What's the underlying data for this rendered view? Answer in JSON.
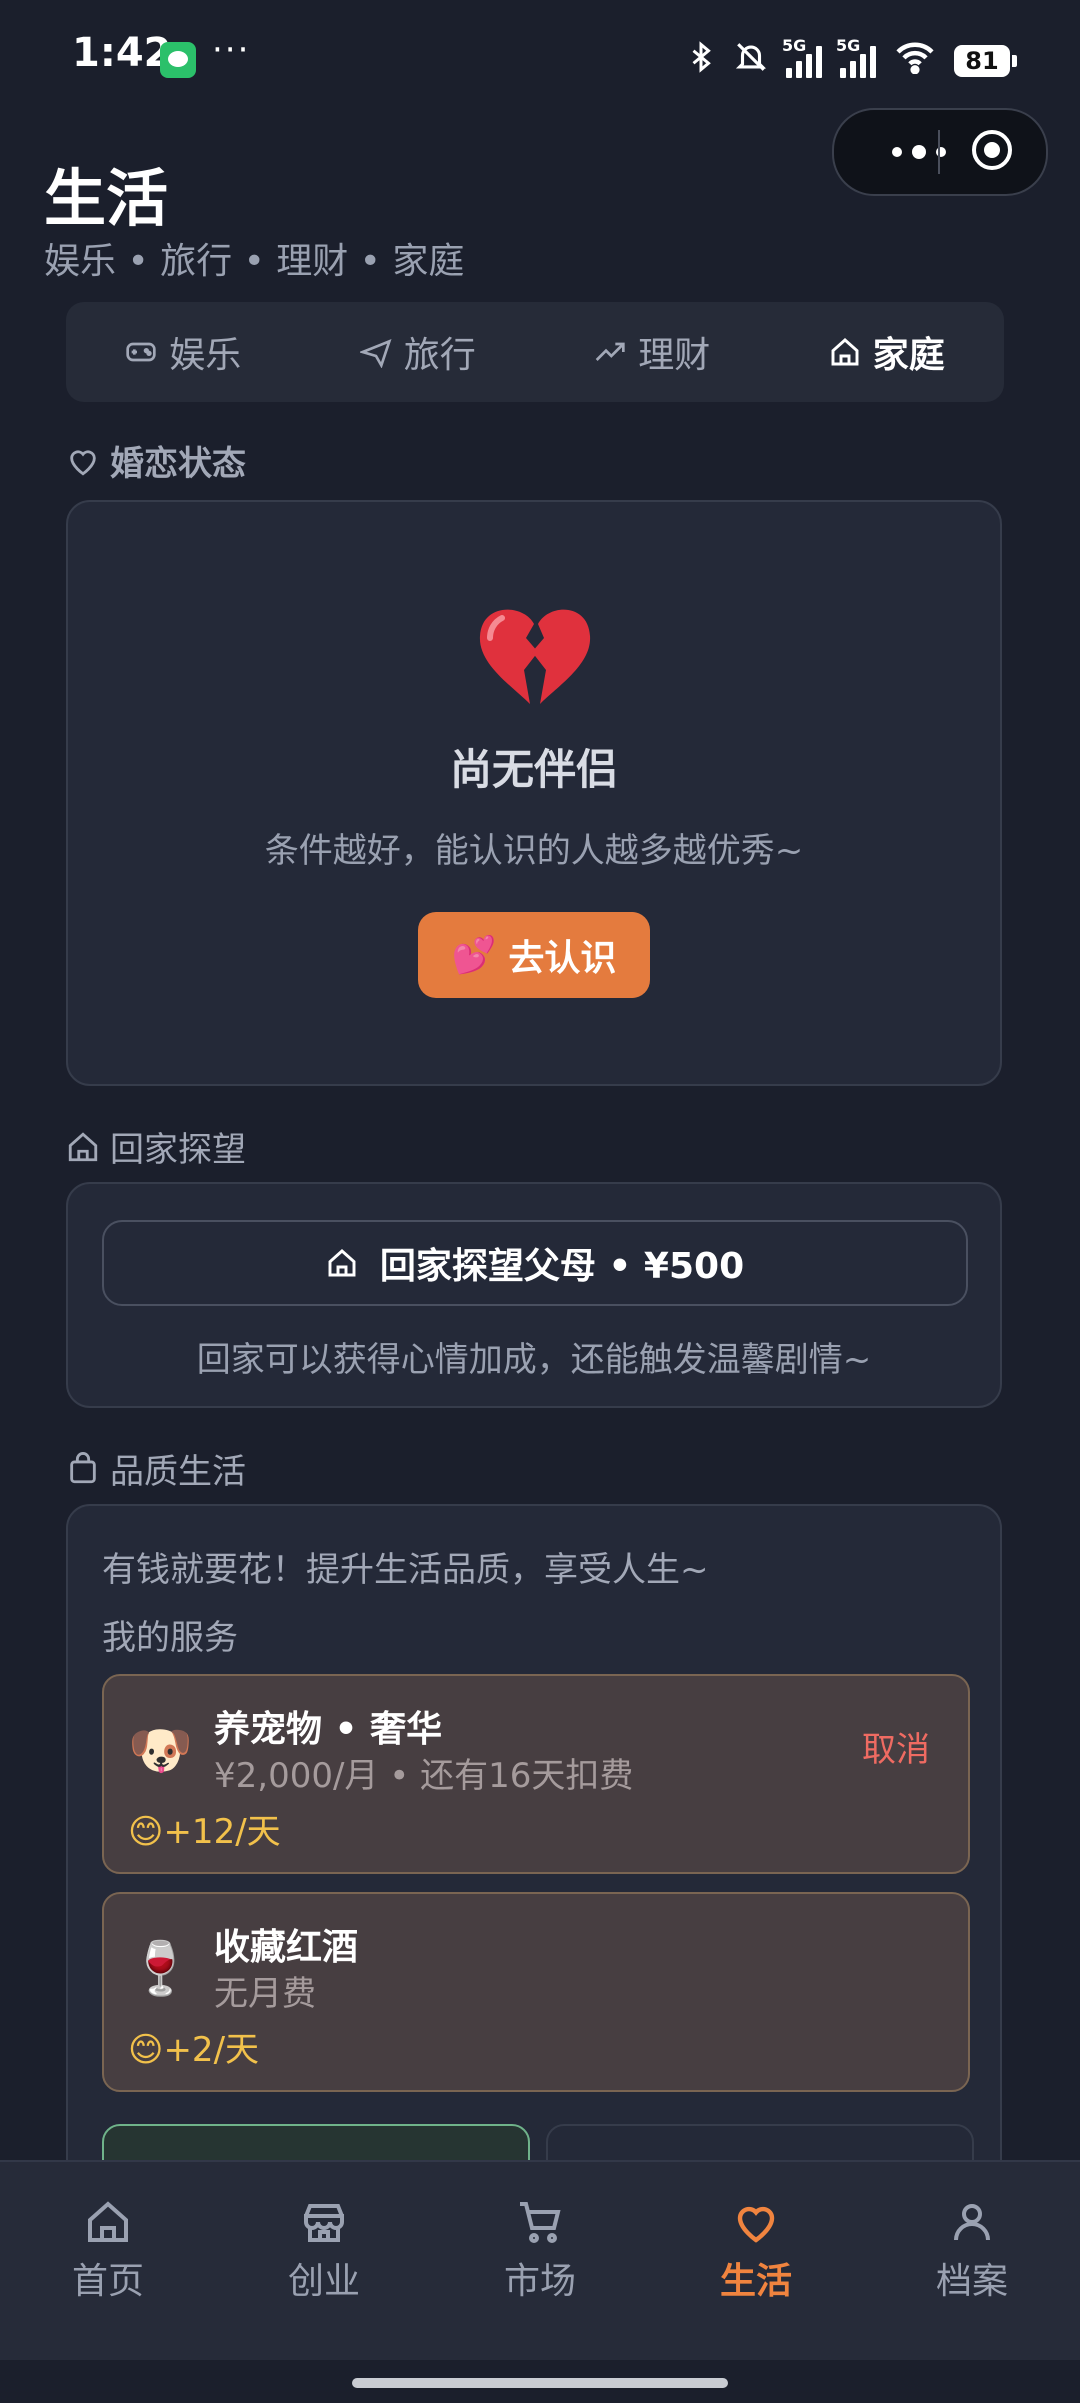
{
  "status_bar": {
    "time": "1:42",
    "more": "···",
    "battery": "81",
    "signal_label": "5G"
  },
  "header": {
    "title": "生活",
    "subtitle": "娱乐 • 旅行 • 理财 • 家庭"
  },
  "tabs": [
    {
      "label": "娱乐",
      "icon": "gamepad-icon",
      "active": false
    },
    {
      "label": "旅行",
      "icon": "plane-icon",
      "active": false
    },
    {
      "label": "理财",
      "icon": "trending-up-icon",
      "active": false
    },
    {
      "label": "家庭",
      "icon": "home-icon",
      "active": true
    }
  ],
  "marriage": {
    "section_title": "婚恋状态",
    "status_emoji": "💔",
    "status_title": "尚无伴侣",
    "status_sub": "条件越好，能认识的人越多越优秀~",
    "button_emoji": "💕",
    "button_label": "去认识"
  },
  "visit_home": {
    "section_title": "回家探望",
    "button_label": "回家探望父母 • ¥500",
    "note": "回家可以获得心情加成，还能触发温馨剧情~"
  },
  "quality_life": {
    "section_title": "品质生活",
    "intro": "有钱就要花！提升生活品质，享受人生~",
    "my_services_label": "我的服务",
    "services": [
      {
        "emoji": "🐶",
        "name": "养宠物 • 奢华",
        "price": "¥2,000/月 • 还有16天扣费",
        "mood": "😊+12/天",
        "cancel": "取消"
      },
      {
        "emoji": "🍷",
        "name": "收藏红酒",
        "price": "无月费",
        "mood": "😊+2/天",
        "cancel": ""
      }
    ]
  },
  "bottom_nav": [
    {
      "label": "首页",
      "icon": "home-icon",
      "active": false
    },
    {
      "label": "创业",
      "icon": "store-icon",
      "active": false
    },
    {
      "label": "市场",
      "icon": "cart-icon",
      "active": false
    },
    {
      "label": "生活",
      "icon": "heart-icon",
      "active": true
    },
    {
      "label": "档案",
      "icon": "user-icon",
      "active": false
    }
  ],
  "colors": {
    "accent": "#f0843f",
    "button_orange": "#e47b3e",
    "mood_yellow": "#f2c14b",
    "cancel_red": "#ef6b62",
    "background": "#1b1f2c"
  }
}
